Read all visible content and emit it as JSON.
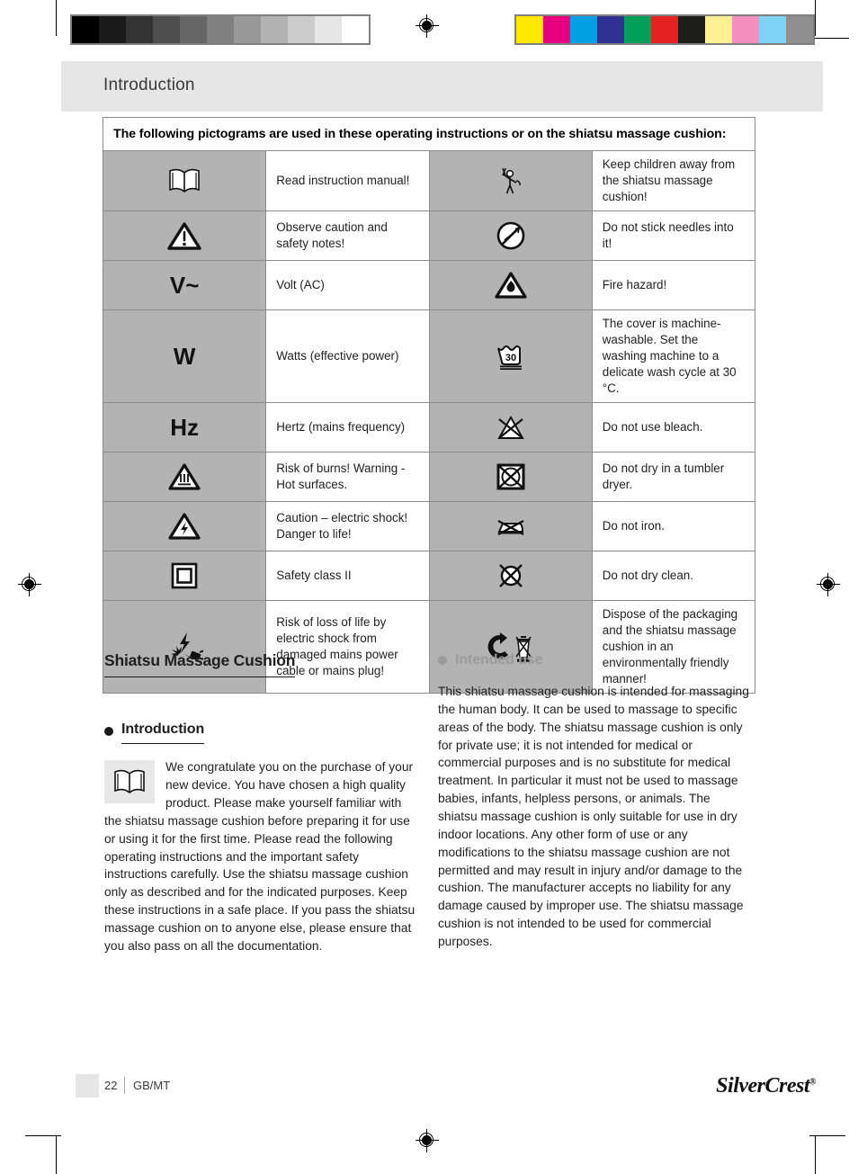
{
  "header": {
    "title": "Introduction"
  },
  "table": {
    "heading": "The following pictograms are used in these operating instructions or on the shiatsu massage cushion:",
    "rows": [
      {
        "left_icon": "open-book-icon",
        "left_text": "Read instruction manual!",
        "right_icon": "keep-children-away-icon",
        "right_text": "Keep children away from the shiatsu massage cushion!"
      },
      {
        "left_icon": "warning-triangle-icon",
        "left_text": "Observe caution and safety notes!",
        "right_icon": "no-needles-icon",
        "right_text": "Do not stick needles into it!"
      },
      {
        "left_icon": "volt-ac-glyph",
        "left_text": "Volt (AC)",
        "right_icon": "fire-hazard-icon",
        "right_text": "Fire hazard!"
      },
      {
        "left_icon": "watts-glyph",
        "left_text": "Watts (effective power)",
        "right_icon": "wash-30-icon",
        "right_text": "The cover is machine-washable. Set the washing machine to a delicate wash cycle at 30 °C."
      },
      {
        "left_icon": "hertz-glyph",
        "left_text": "Hertz (mains frequency)",
        "right_icon": "no-bleach-icon",
        "right_text": "Do not use bleach."
      },
      {
        "left_icon": "hot-surface-icon",
        "left_text": "Risk of burns! Warning - Hot surfaces.",
        "right_icon": "no-tumble-dry-icon",
        "right_text": "Do not dry in a tumbler dryer."
      },
      {
        "left_icon": "electric-shock-icon",
        "left_text": "Caution  –  electric shock! Danger to life!",
        "right_icon": "no-iron-icon",
        "right_text": "Do not iron."
      },
      {
        "left_icon": "safety-class-2-icon",
        "left_text": "Safety class II",
        "right_icon": "no-dry-clean-icon",
        "right_text": "Do not dry clean."
      },
      {
        "left_icon": "damaged-plug-icon",
        "left_text": "Risk of loss of life by electric shock from damaged mains power cable or mains plug!",
        "right_icon": "dispose-recycle-icon",
        "right_text": "Dispose of the packaging and the shiatsu massage cushion in an environmentally friendly manner!"
      }
    ],
    "glyphs": {
      "volt": "V~",
      "watts": "W",
      "hertz": "Hz",
      "wash_temp": "30"
    }
  },
  "content": {
    "product_title": "Shiatsu Massage Cushion",
    "intro_heading": "Introduction",
    "intro_text": "We congratulate you on the purchase of your new device. You have chosen a high quality product. Please make yourself familiar with the shiatsu massage cushion before preparing it for use or using it for the first time. Please read the following operating instructions and the important safety instructions carefully. Use the shiatsu massage cushion only as described and for the indicated purposes. Keep these instructions in a safe place. If you pass the shiatsu massage cushion on to anyone else, please ensure that you also pass on all the documentation.",
    "intended_heading": "Intended use",
    "intended_text": "This shiatsu massage cushion is intended for massaging the human body. It can be used to massage to specific areas of the body. The shiatsu massage cushion is only for private use; it is not intended for medical or commercial purposes and is no substitute for medical treatment. In particular it must not be used to massage babies, infants, helpless persons, or animals. The shiatsu massage cushion is only suitable for use in dry indoor locations. Any other form of use or any modifications to the shiatsu massage cushion are not permitted and may result in injury and/or damage to the cushion. The manufacturer accepts no liability for any damage caused by improper use. The shiatsu massage cushion is not intended to be used for commercial purposes."
  },
  "footer": {
    "page_number": "22",
    "language": "GB/MT",
    "brand_first": "Silver",
    "brand_second": "Crest",
    "brand_mark": "®"
  },
  "calibration": {
    "grayscale": [
      "#000000",
      "#1a1a1a",
      "#333333",
      "#4d4d4d",
      "#666666",
      "#808080",
      "#999999",
      "#b3b3b3",
      "#cccccc",
      "#e6e6e6",
      "#ffffff"
    ],
    "colors": [
      "#ffe900",
      "#e6007e",
      "#00a0e3",
      "#2e3192",
      "#00a05a",
      "#e52421",
      "#1d1d1b",
      "#fdf092",
      "#f48fc0",
      "#7fd4f5",
      "#908f8f"
    ]
  },
  "colors": {
    "header_band": "#e6e6e6",
    "icon_cell": "#b3b3b3",
    "table_border": "#8c8c8c",
    "gray_heading": "#9a9a9a"
  }
}
